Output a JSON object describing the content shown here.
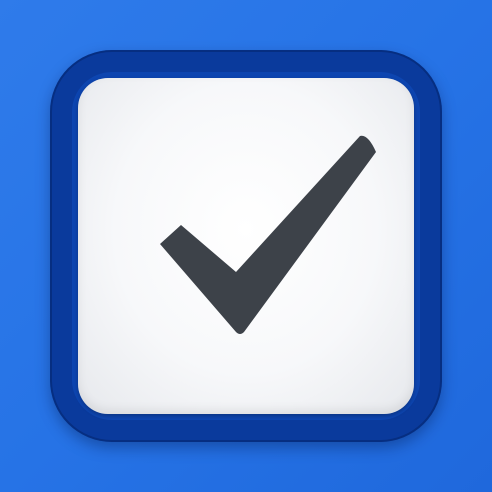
{
  "icon": {
    "name": "checkbox-checked",
    "colors": {
      "background": "#2673e6",
      "frame": "#0a3a9c",
      "face": "#f7f8fa",
      "checkmark": "#3d4249"
    }
  }
}
